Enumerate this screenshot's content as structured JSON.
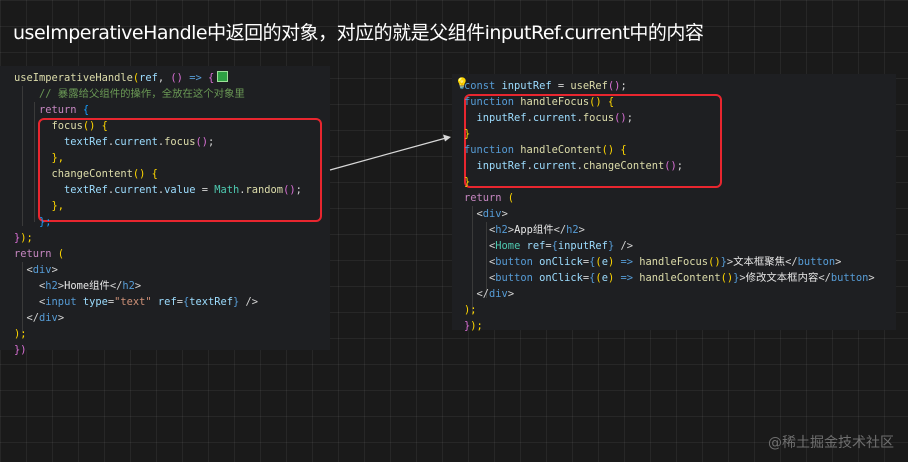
{
  "title": "useImperativeHandle中返回的对象，对应的就是父组件inputRef.current中的内容",
  "left": {
    "l1": {
      "t1": "useImperativeHandle",
      "t2": "(",
      "t3": "ref",
      "t4": ", ",
      "t5": "()",
      "t6": " => ",
      "t7": "{"
    },
    "l2": {
      "t1": "// 暴露给父组件的操作，全放在这个对象里"
    },
    "l3": {
      "t1": "return",
      "t2": " {"
    },
    "l4": {
      "t1": "focus",
      "t2": "()",
      "t3": " {"
    },
    "l5": {
      "t1": "textRef",
      "t2": ".",
      "t3": "current",
      "t4": ".",
      "t5": "focus",
      "t6": "()",
      "t7": ";"
    },
    "l6": {
      "t1": "},"
    },
    "l7": {
      "t1": "changeContent",
      "t2": "()",
      "t3": " {"
    },
    "l8": {
      "t1": "textRef",
      "t2": ".",
      "t3": "current",
      "t4": ".",
      "t5": "value",
      "t6": " = ",
      "t7": "Math",
      "t8": ".",
      "t9": "random",
      "t10": "()",
      "t11": ";"
    },
    "l9": {
      "t1": "},"
    },
    "l10": {
      "t1": "};"
    },
    "l11": {
      "t1": "}",
      "t2": ");"
    },
    "l12": {
      "t1": "return",
      "t2": " ("
    },
    "l13": {
      "t1": "<",
      "t2": "div",
      "t3": ">"
    },
    "l14": {
      "t1": "<",
      "t2": "h2",
      "t3": ">",
      "t4": "Home组件",
      "t5": "</",
      "t6": "h2",
      "t7": ">"
    },
    "l15": {
      "t1": "<",
      "t2": "input",
      "t3": " type",
      "t4": "=",
      "t5": "\"text\"",
      "t6": " ref",
      "t7": "=",
      "t8": "{",
      "t9": "textRef",
      "t10": "}",
      "t11": " />"
    },
    "l16": {
      "t1": "</",
      "t2": "div",
      "t3": ">"
    },
    "l17": {
      "t1": ");"
    },
    "l18": {
      "t1": "})"
    }
  },
  "right": {
    "l1": {
      "t1": "const",
      "t2": " inputRef",
      "t3": " = ",
      "t4": "useRef",
      "t5": "()",
      "t6": ";"
    },
    "l2": {
      "t1": "function",
      "t2": " handleFocus",
      "t3": "()",
      "t4": " {"
    },
    "l3": {
      "t1": "inputRef",
      "t2": ".",
      "t3": "current",
      "t4": ".",
      "t5": "focus",
      "t6": "()",
      "t7": ";"
    },
    "l4": {
      "t1": "}"
    },
    "l5": {
      "t1": "function",
      "t2": " handleContent",
      "t3": "()",
      "t4": " {"
    },
    "l6": {
      "t1": "inputRef",
      "t2": ".",
      "t3": "current",
      "t4": ".",
      "t5": "changeContent",
      "t6": "()",
      "t7": ";"
    },
    "l7": {
      "t1": "}"
    },
    "l8": {
      "t1": "return",
      "t2": " ("
    },
    "l9": {
      "t1": "<",
      "t2": "div",
      "t3": ">"
    },
    "l10": {
      "t1": "<",
      "t2": "h2",
      "t3": ">",
      "t4": "App组件",
      "t5": "</",
      "t6": "h2",
      "t7": ">"
    },
    "l11": {
      "t1": "<",
      "t2": "Home",
      "t3": " ref",
      "t4": "=",
      "t5": "{",
      "t6": "inputRef",
      "t7": "}",
      "t8": " />"
    },
    "l12": {
      "t1": "<",
      "t2": "button",
      "t3": " onClick",
      "t4": "=",
      "t5": "{",
      "t6": "(",
      "t7": "e",
      "t8": ")",
      "t9": " => ",
      "t10": "handleFocus",
      "t11": "()",
      "t12": "}",
      "t13": ">",
      "t14": "文本框聚焦",
      "t15": "</",
      "t16": "button",
      "t17": ">"
    },
    "l13": {
      "t1": "<",
      "t2": "button",
      "t3": " onClick",
      "t4": "=",
      "t5": "{",
      "t6": "(",
      "t7": "e",
      "t8": ")",
      "t9": " => ",
      "t10": "handleContent",
      "t11": "()",
      "t12": "}",
      "t13": ">",
      "t14": "修改文本框内容",
      "t15": "</",
      "t16": "button",
      "t17": ">"
    },
    "l14": {
      "t1": "</",
      "t2": "div",
      "t3": ">"
    },
    "l15": {
      "t1": ");"
    },
    "l16": {
      "t1": "}",
      "t2": ");"
    }
  },
  "watermark": "@稀土掘金技术社区",
  "icons": {
    "bulb": "lightbulb-icon",
    "color_box": "color-square-icon",
    "arrow": "arrow-icon"
  },
  "colors": {
    "highlight": "#e8262f",
    "background": "#1a1a1a",
    "panel": "#1e1f22"
  }
}
